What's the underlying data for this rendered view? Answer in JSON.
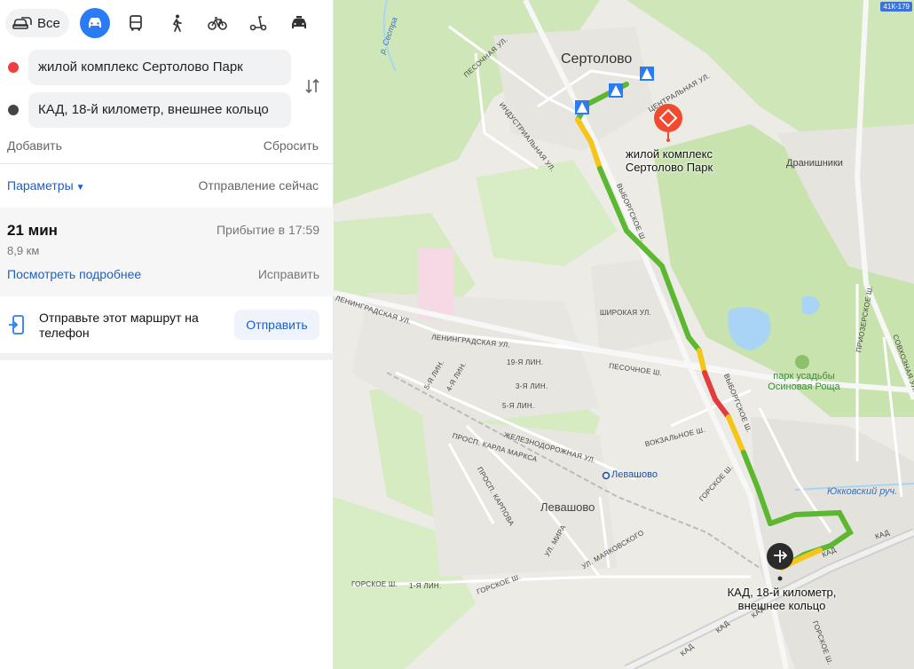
{
  "modes": {
    "all_label": "Все",
    "items": [
      {
        "name": "car-mode-button",
        "icon": "car-icon",
        "active": true
      },
      {
        "name": "bus-mode-button",
        "icon": "bus-icon",
        "active": false
      },
      {
        "name": "walk-mode-button",
        "icon": "walk-icon",
        "active": false
      },
      {
        "name": "bike-mode-button",
        "icon": "bike-icon",
        "active": false
      },
      {
        "name": "scooter-mode-button",
        "icon": "scooter-icon",
        "active": false
      },
      {
        "name": "taxi-mode-button",
        "icon": "taxi-icon",
        "active": false
      }
    ]
  },
  "route_form": {
    "from_value": "жилой комплекс Сертолово Парк",
    "to_value": "КАД, 18-й километр, внешнее кольцо",
    "from_dot_color": "#f03e3e",
    "to_dot_color": "#444444",
    "add_label": "Добавить",
    "reset_label": "Сбросить"
  },
  "options": {
    "params_label": "Параметры",
    "departure_label": "Отправление сейчас"
  },
  "route": {
    "duration": "21 мин",
    "distance": "8,9 км",
    "arrival": "Прибытие в 17:59",
    "details_label": "Посмотреть подробнее",
    "fix_label": "Исправить"
  },
  "send": {
    "text": "Отправьте этот маршрут на телефон",
    "button_label": "Отправить"
  },
  "map": {
    "road_badge": "41К-179",
    "labels": {
      "city_sertolovo": "Сертолово",
      "city_levashovo": "Левашово",
      "drani": "Дранишники",
      "park": "парк усадьбы Осиновая Роща",
      "water": "Юкковский руч.",
      "station": "Левашово",
      "start_poi": "жилой комплекс Сертолово Парк",
      "end_poi": "КАД, 18-й километр, внешнее кольцо",
      "vyborgskoe_1": "ВЫБОРГСКОЕ Ш.",
      "vyborgskoe_2": "ВЫБОРГСКОЕ Ш.",
      "leningradskaya_1": "ЛЕНИНГРАДСКАЯ УЛ.",
      "leningradskaya_2": "ЛЕНИНГРАДСКАЯ УЛ.",
      "pesochnoe": "ПЕСОЧНОЕ Ш.",
      "pesochnaya": "ПЕСОЧНАЯ УЛ.",
      "industrialnaya": "ИНДУСТРИАЛЬНАЯ УЛ.",
      "shirokaya": "ШИРОКАЯ УЛ.",
      "vokzalnoe": "ВОКЗАЛЬНОЕ Ш.",
      "gorskoe_1": "ГОРСКОЕ Ш.",
      "gorskoe_2": "ГОРСКОЕ Ш.",
      "gorskoe_3": "ГОРСКОЕ Ш.",
      "zheleznodorozhnaya": "ЖЕЛЕЗНОДОРОЖНАЯ УЛ.",
      "karla_marksa": "ПРОСП. КАРЛА МАРКСА",
      "karpova": "ПРОСП. КАРПОВА",
      "mira": "УЛ. МИРА",
      "mayakovskogo": "УЛ. МАЯКОВСКОГО",
      "kad_1": "КАД",
      "kad_2": "КАД",
      "kad_3": "КАД",
      "kad_4": "КАД",
      "kad_5": "КАД",
      "priozerskoe": "ПРИОЗЕРСКОЕ Ш.",
      "sovkhoznaya": "СОВХОЗНАЯ УЛ.",
      "tsentralnaya": "ЦЕНТРАЛЬНАЯ УЛ.",
      "ul19": "19-Я ЛИН.",
      "ul3": "3-Я ЛИН.",
      "ul5": "5-Я ЛИН.",
      "ul5b": "5-Я ЛИН.",
      "ul4": "4-Я ЛИН.",
      "ul1": "1-Я ЛИН.",
      "gorskoe_4": "ГОРСКОЕ Ш.",
      "sestra": "р. Сестра"
    },
    "colors": {
      "route_green": "#5cb830",
      "route_yellow": "#f5c518",
      "route_red": "#e23c3c",
      "forest": "#c8e4b0",
      "water": "#a9d4f5"
    }
  }
}
